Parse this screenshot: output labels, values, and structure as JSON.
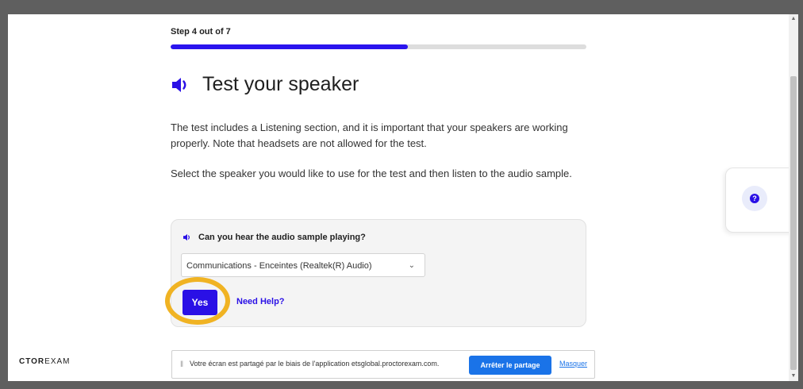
{
  "step": {
    "label": "Step 4 out of 7",
    "progress": 0.57
  },
  "header": {
    "title": "Test your speaker"
  },
  "content": {
    "paragraph1": "The test includes a Listening section, and it is important that your speakers are working properly. Note that headsets are not allowed for the test.",
    "paragraph2": "Select the speaker you would like to use for the test and then listen to the audio sample."
  },
  "card": {
    "question": "Can you hear the audio sample playing?",
    "selected_speaker": "Communications - Enceintes (Realtek(R) Audio)",
    "yes_label": "Yes",
    "need_help_label": "Need Help?"
  },
  "help": {
    "icon_label": "?"
  },
  "logo": {
    "part1": "CTOR",
    "part2": "EXAM"
  },
  "share_bar": {
    "grip_icon": "‖",
    "message": "Votre écran est partagé par le biais de l'application etsglobal.proctorexam.com.",
    "stop_label": "Arrêter le partage",
    "hide_label": "Masquer"
  },
  "colors": {
    "accent": "#2a10e6",
    "highlight_ring": "#f0b323",
    "chrome_blue": "#1a73e8"
  },
  "icons": [
    "speaker-icon",
    "help-icon",
    "chevron-down-icon"
  ]
}
